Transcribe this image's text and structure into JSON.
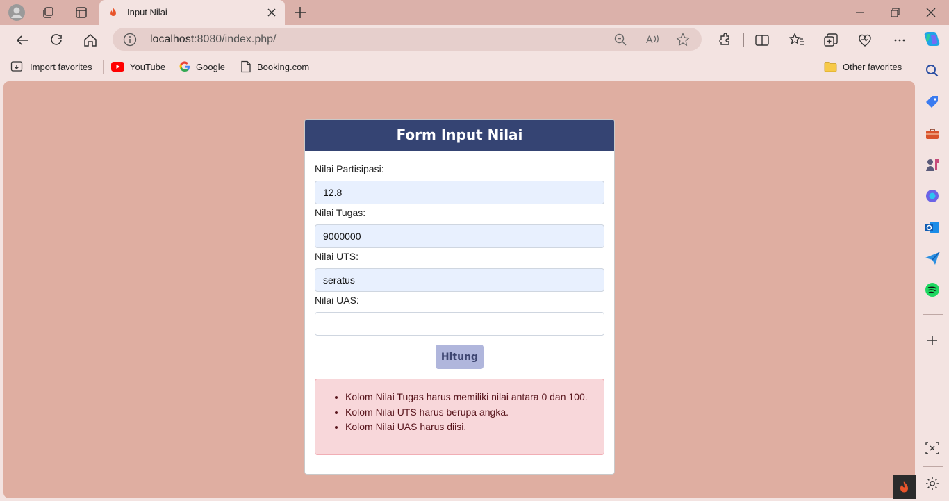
{
  "browser": {
    "tab": {
      "title": "Input Nilai",
      "favicon": "codeigniter-flame-icon"
    },
    "address": {
      "host": "localhost",
      "rest": ":8080/index.php/"
    },
    "favorites": [
      {
        "label": "Import favorites",
        "icon": "import-favorites-icon"
      },
      {
        "label": "YouTube",
        "icon": "youtube-icon"
      },
      {
        "label": "Google",
        "icon": "google-icon"
      },
      {
        "label": "Booking.com",
        "icon": "page-icon"
      }
    ],
    "other_favorites": "Other favorites"
  },
  "colors": {
    "titlebar": "#dbb1aa",
    "page_background": "#dfaea1",
    "card_header": "#354473",
    "button": "#b0b6dc",
    "alert_background": "#f8d7da",
    "alert_text": "#58151c"
  },
  "form": {
    "title": "Form Input Nilai",
    "fields": [
      {
        "label": "Nilai Partisipasi:",
        "value": "12.8"
      },
      {
        "label": "Nilai Tugas:",
        "value": "9000000"
      },
      {
        "label": "Nilai UTS:",
        "value": "seratus"
      },
      {
        "label": "Nilai UAS:",
        "value": ""
      }
    ],
    "submit_label": "Hitung",
    "errors": [
      "Kolom Nilai Tugas harus memiliki nilai antara 0 dan 100.",
      "Kolom Nilai UTS harus berupa angka.",
      "Kolom Nilai UAS harus diisi."
    ]
  }
}
